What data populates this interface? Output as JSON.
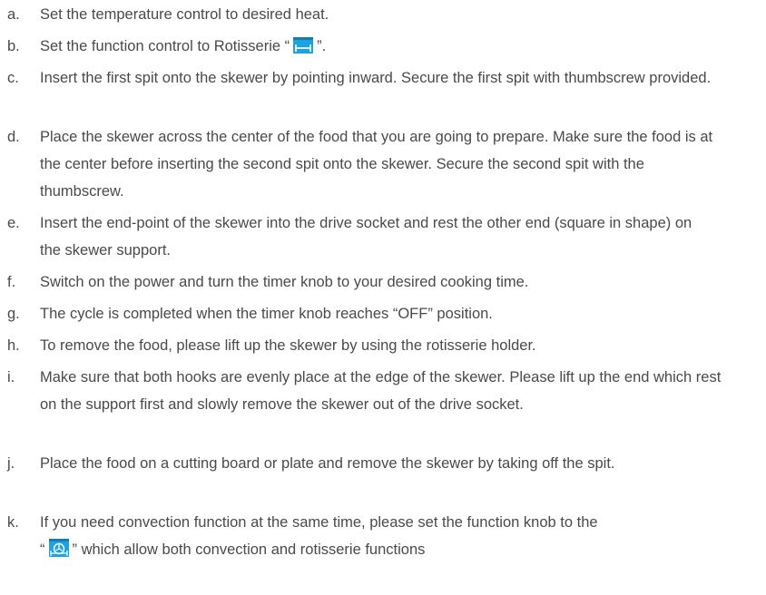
{
  "icons": {
    "rotisserie": "rotisserie-icon",
    "convection_rotisserie": "convection-rotisserie-icon",
    "accent_color": "#1ea3dd"
  },
  "steps": [
    {
      "letter": "a.",
      "text": "Set the temperature control to desired heat."
    },
    {
      "letter": "b.",
      "text_before": "Set the function control to Rotisserie “",
      "text_after": "”."
    },
    {
      "letter": "c.",
      "text": "Insert the first spit onto the skewer by pointing inward. Secure the first spit with thumbscrew provided."
    },
    {
      "letter": "d.",
      "text": "Place the skewer across the center of the food that you are going to prepare. Make sure the food is at the center before inserting the second spit onto the skewer. Secure the second spit with the thumbscrew."
    },
    {
      "letter": "e.",
      "text": "Insert the end-point of the skewer into the drive socket and rest the other end (square in shape) on the skewer support."
    },
    {
      "letter": "f.",
      "text": "Switch on the power and turn the timer knob to your desired cooking time."
    },
    {
      "letter": "g.",
      "text": "The cycle is completed when the timer knob reaches “OFF” position."
    },
    {
      "letter": "h.",
      "text": "To remove the food, please lift up the skewer by using the rotisserie holder."
    },
    {
      "letter": "i.",
      "text": "Make sure that both hooks are evenly place at the edge of the skewer. Please lift up the end which rest on the support first and slowly remove the skewer out of the drive socket."
    },
    {
      "letter": "j.",
      "text": "Place the food on a cutting board or plate and remove the skewer by taking off the spit."
    },
    {
      "letter": "k.",
      "text_line1": "If you need convection function at the same time, please set the function knob to the",
      "text_before": "“",
      "text_after": "” which allow both convection and rotisserie functions"
    }
  ]
}
